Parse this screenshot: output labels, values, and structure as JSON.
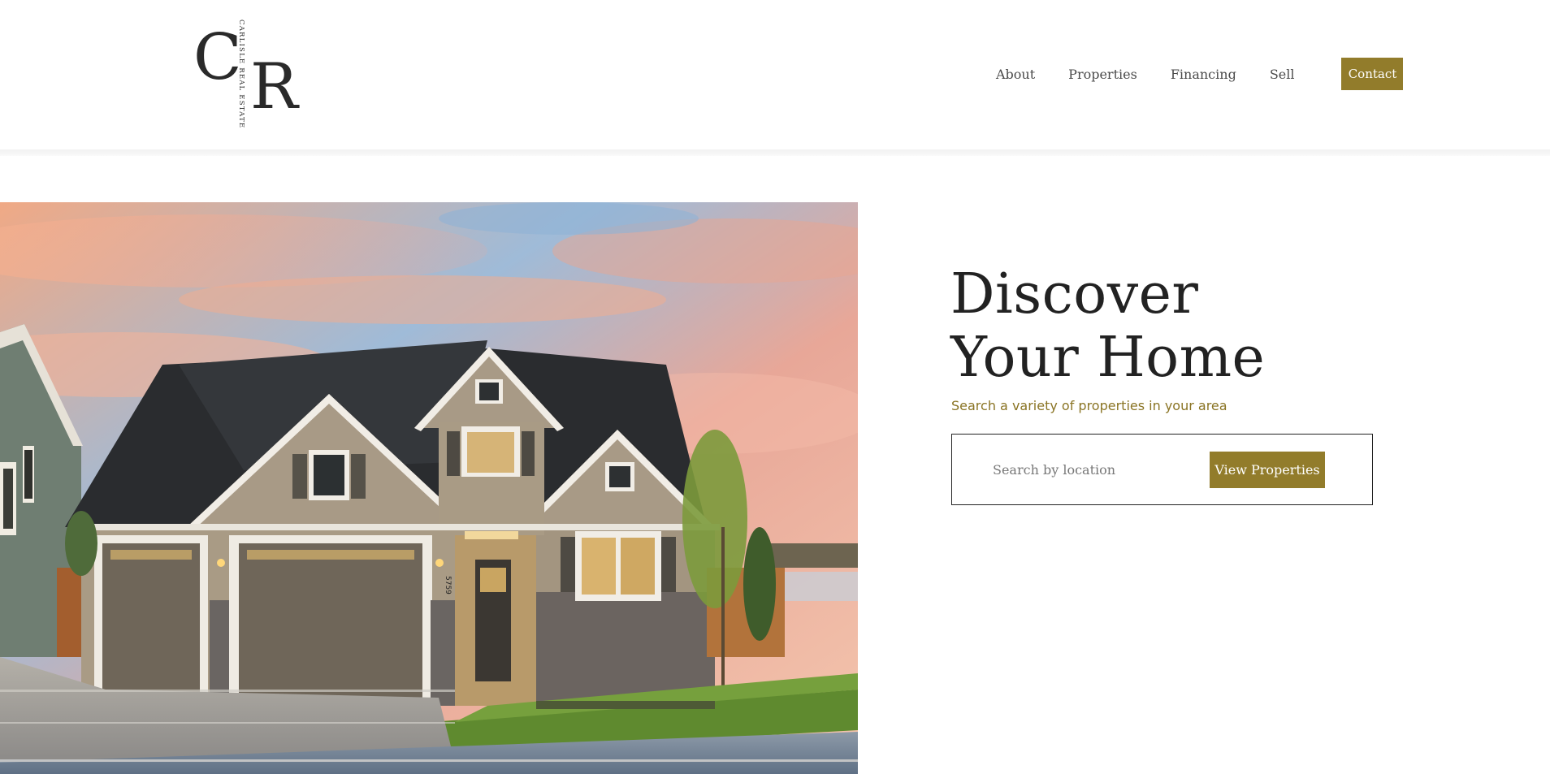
{
  "brand": {
    "monogram_left": "C",
    "monogram_right": "R",
    "name": "CARLISLE REAL ESTATE"
  },
  "nav": {
    "items": [
      {
        "label": "About"
      },
      {
        "label": "Properties"
      },
      {
        "label": "Financing"
      },
      {
        "label": "Sell"
      }
    ],
    "contact_label": "Contact"
  },
  "hero": {
    "title_line1": "Discover",
    "title_line2": "Your Home",
    "subtitle": "Search a variety of properties in your area",
    "search": {
      "placeholder": "Search by location",
      "button_label": "View Properties"
    },
    "image": {
      "house_number": "5759"
    }
  },
  "colors": {
    "accent": "#927c2b",
    "text_dark": "#222222",
    "subtitle": "#8a7424"
  }
}
